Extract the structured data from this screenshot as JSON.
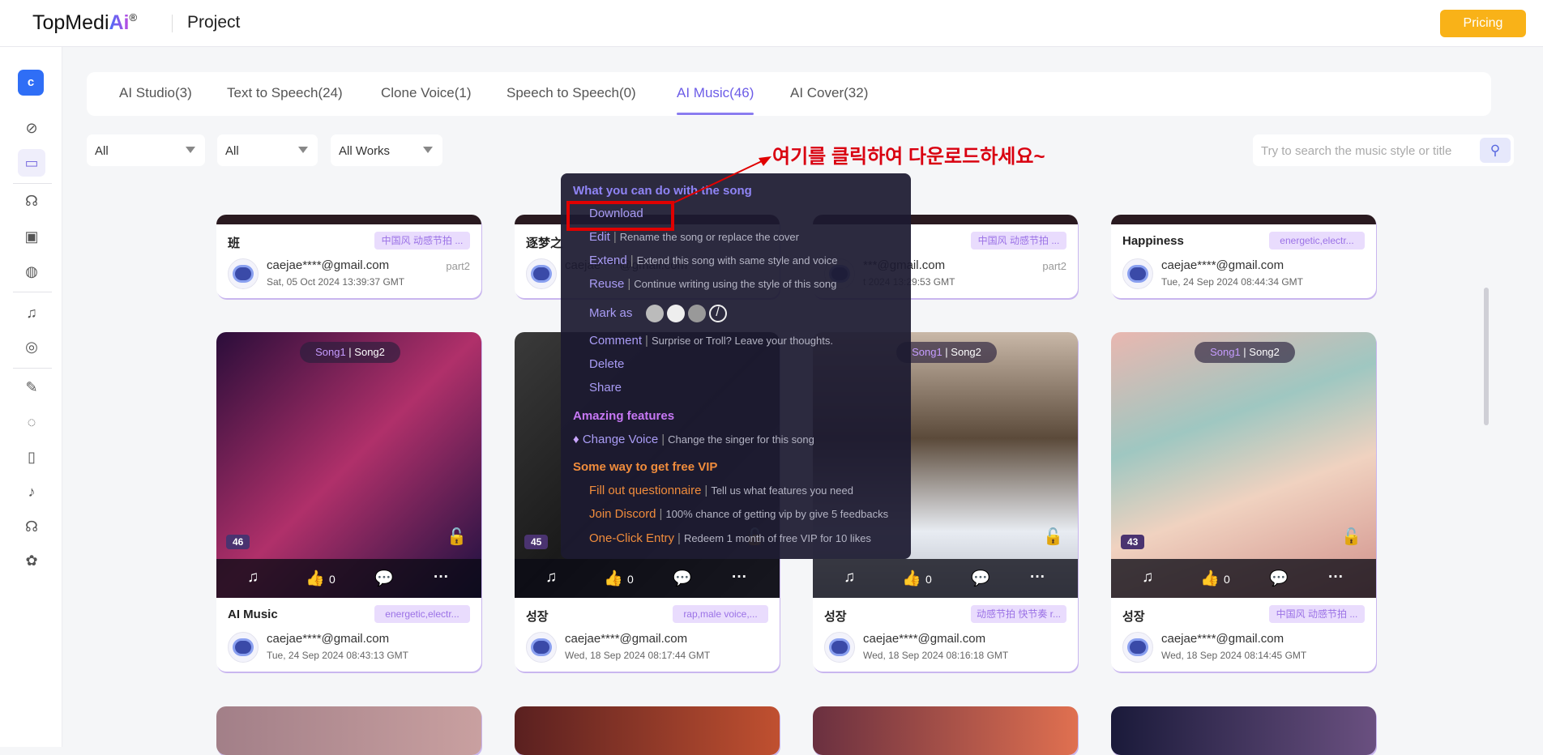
{
  "header": {
    "logo": "TopMediAi",
    "logo_ai": "Ai",
    "logo_reg": "®",
    "title": "Project",
    "pricing": "Pricing"
  },
  "sidebar": {
    "avatar": "c",
    "icons": [
      "palette-leaf-icon",
      "folder-icon",
      "voice-chat-icon",
      "voice-box-icon",
      "globe-icon",
      "music-note-icon",
      "disc-icon",
      "microphone-icon",
      "audio-wave-icon",
      "audio-file-icon",
      "tiktok-icon",
      "voice-chat-alt-icon",
      "palette-icon"
    ]
  },
  "tabs": [
    {
      "label": "AI Studio(3)"
    },
    {
      "label": "Text to Speech(24)"
    },
    {
      "label": "Clone Voice(1)"
    },
    {
      "label": "Speech to Speech(0)"
    },
    {
      "label": "AI Music(46)",
      "active": true
    },
    {
      "label": "AI Cover(32)"
    }
  ],
  "filters": [
    "All",
    "All",
    "All Works"
  ],
  "search": {
    "placeholder": "Try to search the music style or title"
  },
  "annotation": "여기를 클릭하여 다운로드하세요~",
  "accent": "#6c5ce7",
  "cards_top": [
    {
      "title": "班",
      "tag": "中国风 动感节拍 ...",
      "email": "caejae****@gmail.com",
      "date": "Sat, 05 Oct 2024 13:39:37 GMT",
      "part": "part2"
    },
    {
      "title": "逐梦之",
      "tag": "",
      "email": "caejae****@gmail.com",
      "date": "",
      "part": ""
    },
    {
      "title": "",
      "tag": "中国风 动感节拍 ...",
      "email": "***@gmail.com",
      "date": "t 2024 13:29:53 GMT",
      "part": "part2"
    },
    {
      "title": "Happiness",
      "tag": "energetic,electr...",
      "email": "caejae****@gmail.com",
      "date": "Tue, 24 Sep 2024 08:44:34 GMT",
      "part": ""
    }
  ],
  "cards": [
    {
      "num": "46",
      "title": "AI Music",
      "tag": "energetic,electr...",
      "email": "caejae****@gmail.com",
      "date": "Tue, 24 Sep 2024 08:43:13 GMT",
      "likes": "0",
      "song1": "Song1",
      "song2": "Song2"
    },
    {
      "num": "45",
      "title": "성장",
      "tag": "rap,male voice,...",
      "email": "caejae****@gmail.com",
      "date": "Wed, 18 Sep 2024 08:17:44 GMT",
      "likes": "0",
      "song1": "",
      "song2": ""
    },
    {
      "num": "",
      "title": "성장",
      "tag": "动感节拍 快节奏 r...",
      "email": "caejae****@gmail.com",
      "date": "Wed, 18 Sep 2024 08:16:18 GMT",
      "likes": "0",
      "song1": "Song1",
      "song2": "Song2"
    },
    {
      "num": "43",
      "title": "성장",
      "tag": "中国风 动感节拍 ...",
      "email": "caejae****@gmail.com",
      "date": "Wed, 18 Sep 2024 08:14:45 GMT",
      "likes": "0",
      "song1": "Song1",
      "song2": "Song2"
    }
  ],
  "menu": {
    "header": "What you can do with the song",
    "download": "Download",
    "edit": "Edit",
    "edit_desc": "Rename the song or replace the cover",
    "extend": "Extend",
    "extend_desc": "Extend this song with same style and voice",
    "reuse": "Reuse",
    "reuse_desc": "Continue writing using the style of this song",
    "mark_as": "Mark as",
    "comment": "Comment",
    "comment_desc": "Surprise or Troll? Leave your thoughts.",
    "delete": "Delete",
    "share": "Share",
    "amazing": "Amazing features",
    "change_voice": "Change Voice",
    "change_voice_desc": "Change the singer for this song",
    "free_vip": "Some way to get free VIP",
    "fill": "Fill out questionnaire",
    "fill_desc": "Tell us what features you need",
    "discord": "Join Discord",
    "discord_desc": "100% chance of getting vip by give 5 feedbacks",
    "oneclick": "One-Click Entry",
    "oneclick_desc": "Redeem 1 month of free VIP for 10 likes"
  }
}
